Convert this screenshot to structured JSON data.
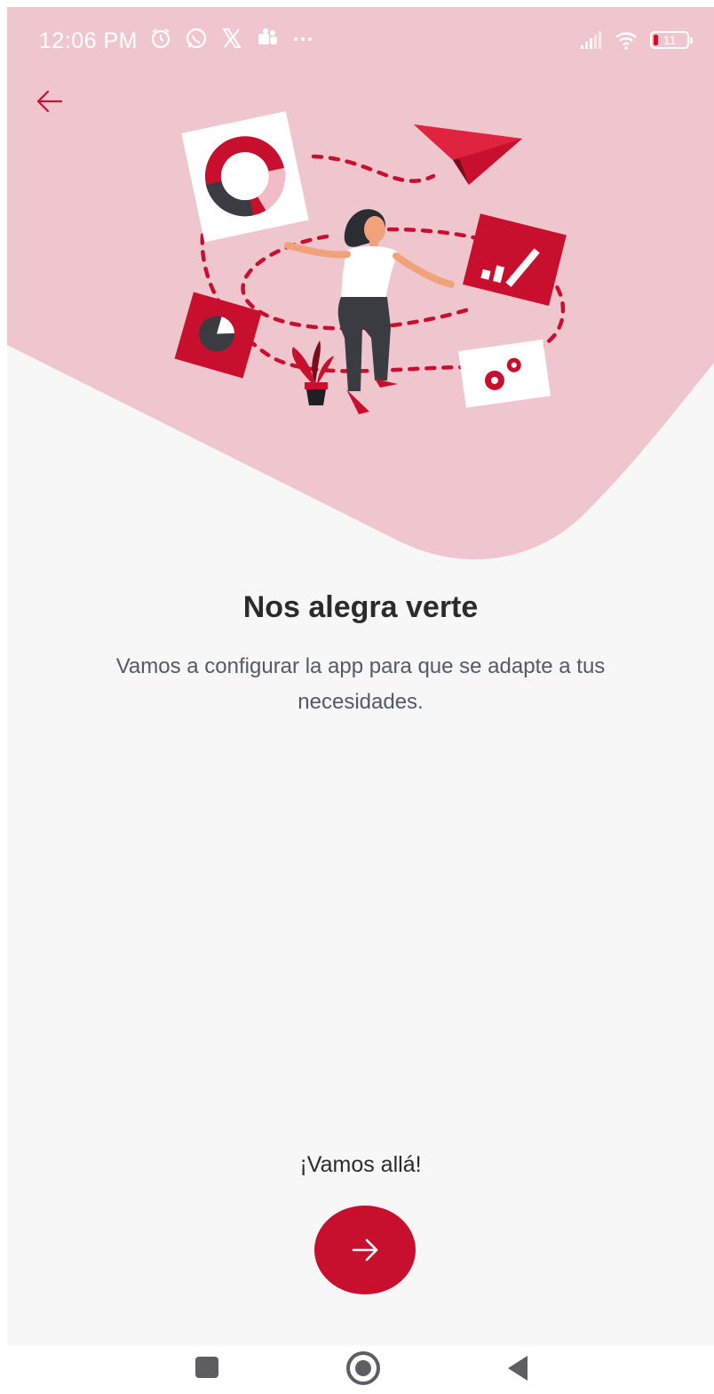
{
  "colors": {
    "accent": "#c8102e",
    "hero_background": "#efc6ce",
    "screen_background": "#f7f7f7"
  },
  "status_bar": {
    "time": "12:06 PM",
    "left_icons": [
      "alarm-icon",
      "whatsapp-icon",
      "x-icon",
      "teams-icon",
      "more-dots-icon"
    ],
    "right_icons": [
      "signal-icon",
      "wifi-icon",
      "battery-icon"
    ],
    "battery_level": "11"
  },
  "header": {
    "back_icon": "arrow-left-icon"
  },
  "main": {
    "title": "Nos alegra verte",
    "subtitle": "Vamos a configurar la app para que se adapte a tus necesidades.",
    "cta_label": "¡Vamos allá!",
    "next_icon": "arrow-right-icon"
  },
  "navigation_bar": {
    "buttons": [
      "recents-square-icon",
      "home-circle-icon",
      "back-triangle-icon"
    ]
  }
}
